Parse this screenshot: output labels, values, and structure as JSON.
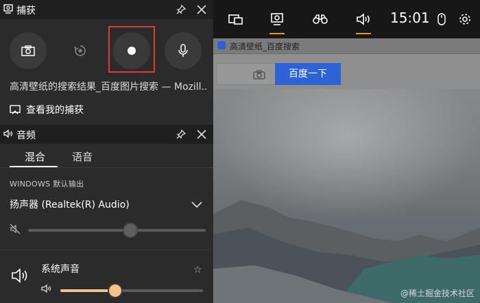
{
  "browser": {
    "tab_title": "高清壁纸_百度搜索",
    "search_button": "百度一下",
    "watermark": "@稀土掘金技术社区"
  },
  "gamebar": {
    "time": "15:01",
    "widgets": [
      "widget-menu-icon",
      "capture-icon",
      "binoculars-icon",
      "audio-icon"
    ],
    "accent": "#e79b2f"
  },
  "capture": {
    "title": "捕获",
    "window_name": "高清壁纸的搜索结果_百度图片搜索 — Mozill...",
    "view_captures": "查看我的捕获",
    "record_highlight_color": "#e23a3a"
  },
  "audio": {
    "title": "音频",
    "tabs": [
      "混合",
      "语音"
    ],
    "output_label": "WINDOWS 默认输出",
    "device": "扬声器 (Realtek(R) Audio)",
    "master_volume_fraction": 0.57,
    "app_name": "系统声音",
    "app_volume_fraction": 0.38,
    "app_volume_color": "#f2c38a"
  }
}
